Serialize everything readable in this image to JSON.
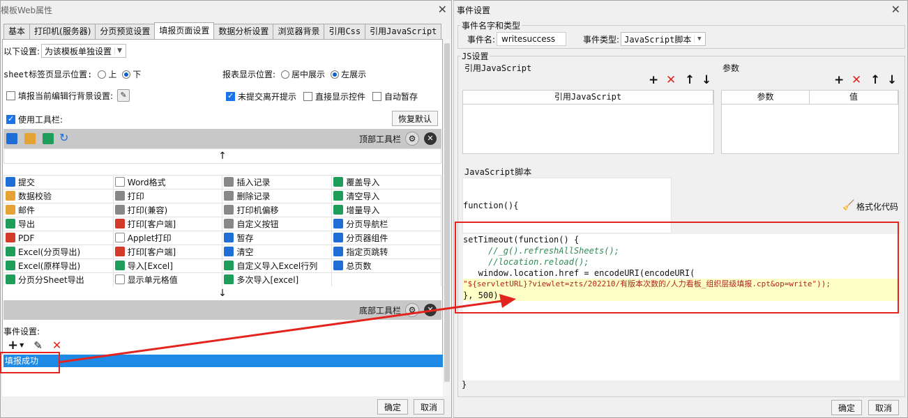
{
  "left_window": {
    "title": "模板Web属性",
    "tabs": [
      "基本",
      "打印机(服务器)",
      "分页预览设置",
      "填报页面设置",
      "数据分析设置",
      "浏览器背景",
      "引用Css",
      "引用JavaScript"
    ],
    "active_tab": "填报页面设置",
    "scope_label": "以下设置:",
    "scope_value": "为该模板单独设置",
    "sheet_pos_label": "sheet标签页显示位置:",
    "sheet_pos_opts": [
      "上",
      "下"
    ],
    "report_pos_label": "报表显示位置:",
    "report_pos_opts": [
      "居中展示",
      "左展示"
    ],
    "bg_label": "填报当前编辑行背景设置:",
    "unsubmit_label": "未提交离开提示",
    "direct_ctrl_label": "直接显示控件",
    "autosave_label": "自动暂存",
    "use_toolbar_label": "使用工具栏:",
    "restore_label": "恢复默认",
    "top_toolbar_label": "顶部工具栏",
    "bottom_toolbar_label": "底部工具栏",
    "grid": [
      [
        {
          "t": "提交",
          "i": "blue"
        },
        {
          "t": "Word格式",
          "i": "doc"
        },
        {
          "t": "插入记录",
          "i": "gray"
        },
        {
          "t": "覆盖导入",
          "i": "green"
        }
      ],
      [
        {
          "t": "数据校验",
          "i": "orange"
        },
        {
          "t": "打印",
          "i": "gray"
        },
        {
          "t": "删除记录",
          "i": "gray"
        },
        {
          "t": "清空导入",
          "i": "green"
        }
      ],
      [
        {
          "t": "邮件",
          "i": "orange"
        },
        {
          "t": "打印(兼容)",
          "i": "gray"
        },
        {
          "t": "打印机偏移",
          "i": "gray"
        },
        {
          "t": "增量导入",
          "i": "green"
        }
      ],
      [
        {
          "t": "导出",
          "i": "green"
        },
        {
          "t": "打印[客户端]",
          "i": "red"
        },
        {
          "t": "自定义按钮",
          "i": "gray"
        },
        {
          "t": "分页导航栏",
          "i": "blue"
        }
      ],
      [
        {
          "t": "PDF",
          "i": "red"
        },
        {
          "t": "Applet打印",
          "i": "doc"
        },
        {
          "t": "暂存",
          "i": "blue"
        },
        {
          "t": "分页器组件",
          "i": "blue"
        }
      ],
      [
        {
          "t": "Excel(分页导出)",
          "i": "green"
        },
        {
          "t": "打印[客户端]",
          "i": "red"
        },
        {
          "t": "清空",
          "i": "blue"
        },
        {
          "t": "指定页跳转",
          "i": "blue"
        }
      ],
      [
        {
          "t": "Excel(原样导出)",
          "i": "green"
        },
        {
          "t": "导入[Excel]",
          "i": "green"
        },
        {
          "t": "自定义导入Excel行列",
          "i": "green"
        },
        {
          "t": "总页数",
          "i": "blue"
        }
      ],
      [
        {
          "t": "分页分Sheet导出",
          "i": "green"
        },
        {
          "t": "显示单元格值",
          "i": "doc"
        },
        {
          "t": "多次导入[excel]",
          "i": "green"
        },
        {
          "t": "",
          "i": ""
        }
      ]
    ],
    "event_label": "事件设置:",
    "event_selected": "填报成功",
    "ok": "确定",
    "cancel": "取消"
  },
  "right_window": {
    "title": "事件设置",
    "name_group": "事件名字和类型",
    "name_label": "事件名:",
    "name_value": "writesuccess",
    "type_label": "事件类型:",
    "type_value": "JavaScript脚本",
    "js_group": "JS设置",
    "ref_js_label": "引用JavaScript",
    "ref_js_col": "引用JavaScript",
    "params_label": "参数",
    "params_cols": [
      "参数",
      "值"
    ],
    "script_label": "JavaScript脚本",
    "func_header": "function(){",
    "format_label": "格式化代码",
    "code_lines": [
      "setTimeout(function() {",
      "     //_g().refreshAllSheets();",
      "     //location.reload();",
      "   window.location.href = encodeURI(encodeURI(",
      "\"${servletURL}?viewlet=zts/202210/有版本次数的/人力看板_组织层级填报.cpt&op=write\"));",
      "}, 500)"
    ],
    "closing": "}",
    "ok": "确定",
    "cancel": "取消"
  },
  "colors": {
    "selection": "#1e8ae6",
    "annotation": "#e3241e"
  }
}
